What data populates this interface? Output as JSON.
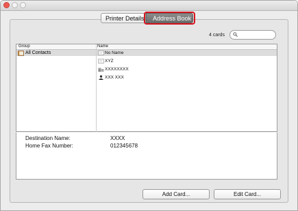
{
  "tabs": [
    "Printer Details",
    "Address Book"
  ],
  "active_tab": "Address Book",
  "cards_count": "4 cards",
  "search": {
    "value": "",
    "placeholder": ""
  },
  "columns": {
    "group": "Group",
    "name": "Name"
  },
  "groups": [
    {
      "label": "All Contacts",
      "icon": "contacts-book-icon"
    }
  ],
  "names": [
    {
      "label": "No Name",
      "icon": "card-icon",
      "selected": true
    },
    {
      "label": "XYZ",
      "icon": "card-icon",
      "selected": false
    },
    {
      "label": "XXXXXXXX",
      "icon": "building-icon",
      "selected": false
    },
    {
      "label": "XXX XXX",
      "icon": "person-icon",
      "selected": false
    }
  ],
  "details": {
    "destination_name_label": "Destination Name:",
    "destination_name_value": "XXXX",
    "home_fax_label": "Home Fax Number:",
    "home_fax_value": "012345678"
  },
  "buttons": {
    "add_card": "Add Card...",
    "edit_card": "Edit Card..."
  },
  "colors": {
    "highlight": "#d8131c",
    "selection": "#dcdcdc",
    "close": "#ee5a50"
  }
}
